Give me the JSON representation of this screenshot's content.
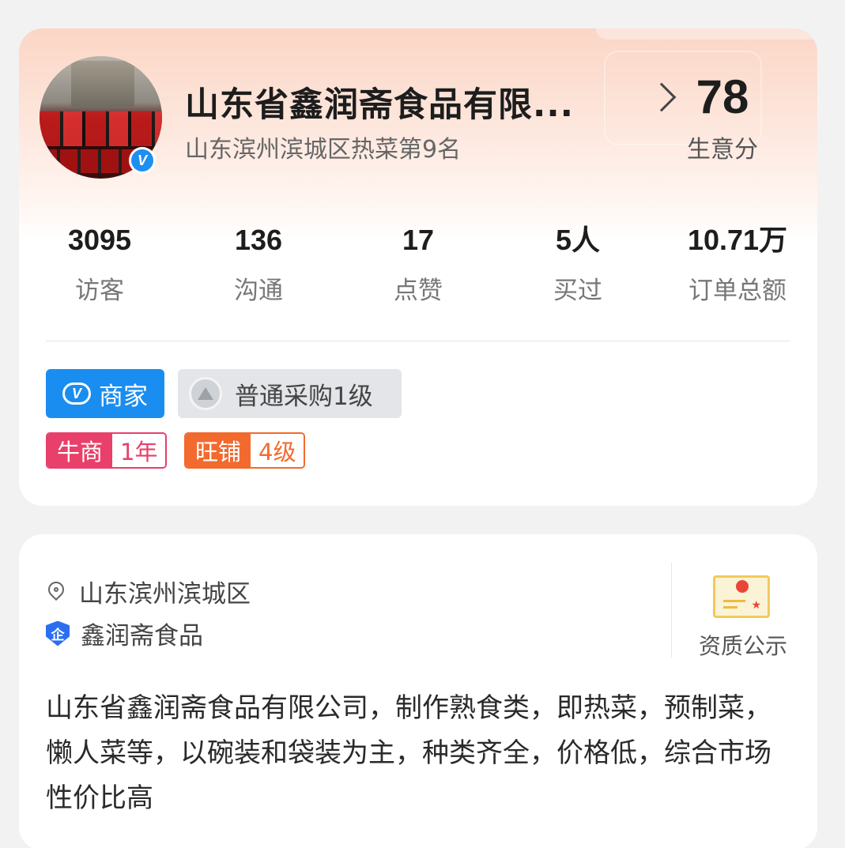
{
  "shop": {
    "name": "山东省鑫润斋食品有限...",
    "rank": "山东滨州滨城区热菜第9名",
    "verified_mark": "V",
    "score": "78",
    "score_label": "生意分"
  },
  "stats": [
    {
      "value": "3095",
      "label": "访客"
    },
    {
      "value": "136",
      "label": "沟通"
    },
    {
      "value": "17",
      "label": "点赞"
    },
    {
      "value": "5人",
      "label": "买过"
    },
    {
      "value": "10.71万",
      "label": "订单总额"
    }
  ],
  "badges": {
    "merchant": {
      "icon_text": "V",
      "label": "商家"
    },
    "purchase_level": {
      "label": "普通采购1级"
    },
    "niushang": {
      "name": "牛商",
      "value": "1年"
    },
    "wangpu": {
      "name": "旺铺",
      "value": "4级"
    }
  },
  "info": {
    "location": "山东滨州滨城区",
    "enterprise_icon_text": "企",
    "enterprise": "鑫润斋食品",
    "cert_label": "资质公示",
    "description": "山东省鑫润斋食品有限公司，制作熟食类，即热菜，预制菜，懒人菜等，以碗装和袋装为主，种类齐全，价格低，综合市场性价比高"
  },
  "icons": [
    "avatar-image",
    "verified-icon",
    "chevron-right-icon",
    "location-pin-icon",
    "enterprise-shield-icon",
    "certificate-icon",
    "level-triangle-icon"
  ],
  "colors": {
    "merchant_blue": "#1a8df0",
    "niushang_pink": "#e8406a",
    "wangpu_orange": "#f26a2e",
    "header_gradient": "#fbd6c6"
  }
}
